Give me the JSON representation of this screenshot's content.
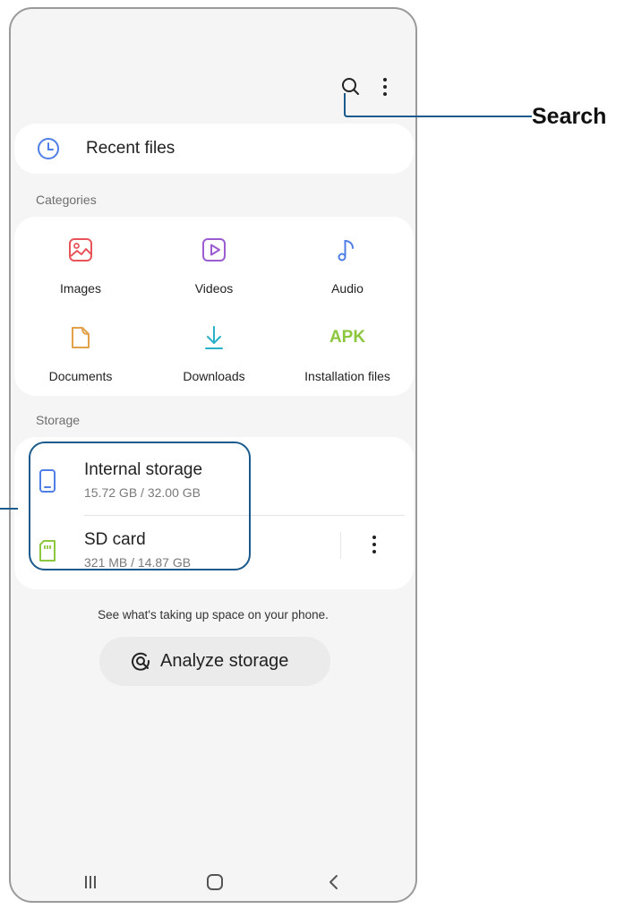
{
  "recent": {
    "label": "Recent files"
  },
  "categories": {
    "title": "Categories",
    "items": [
      {
        "label": "Images",
        "icon": "image-icon",
        "color": "#e8545a"
      },
      {
        "label": "Videos",
        "icon": "video-icon",
        "color": "#9b5bd1"
      },
      {
        "label": "Audio",
        "icon": "music-note-icon",
        "color": "#4f7fe6"
      },
      {
        "label": "Documents",
        "icon": "document-icon",
        "color": "#e3a24a"
      },
      {
        "label": "Downloads",
        "icon": "download-icon",
        "color": "#2ab0c8"
      },
      {
        "label": "Installation files",
        "icon": "apk-icon",
        "icon_text": "APK",
        "color": "#8dc63f"
      }
    ]
  },
  "storage": {
    "title": "Storage",
    "items": [
      {
        "name": "Internal storage",
        "size": "15.72 GB / 32.00 GB",
        "icon": "phone-icon",
        "color": "#4f7fe6"
      },
      {
        "name": "SD card",
        "size": "321 MB / 14.87 GB",
        "icon": "sd-card-icon",
        "color": "#8dc63f"
      }
    ]
  },
  "hint": "See what's taking up space on your phone.",
  "analyze_button": {
    "label": "Analyze storage",
    "icon": "analyze-icon"
  },
  "callout": {
    "label": "Search",
    "color": "#1a5a8c"
  }
}
